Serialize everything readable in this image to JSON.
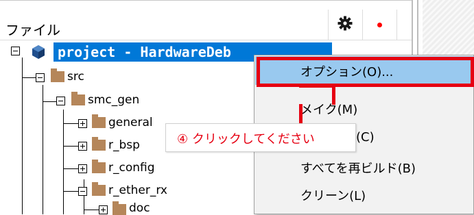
{
  "panel": {
    "header_label": "ファイル",
    "settings_icon": "gear-icon",
    "status_icon": "red-dot-icon",
    "status_color": "#ff0000"
  },
  "tree": {
    "project_label": "project - HardwareDeb",
    "items": [
      {
        "label": "src",
        "state": "expanded"
      },
      {
        "label": "smc_gen",
        "state": "expanded"
      },
      {
        "label": "general",
        "state": "collapsed"
      },
      {
        "label": "r_bsp",
        "state": "collapsed"
      },
      {
        "label": "r_config",
        "state": "collapsed"
      },
      {
        "label": "r_ether_rx",
        "state": "expanded"
      },
      {
        "label": "doc",
        "state": "collapsed"
      }
    ]
  },
  "context_menu": {
    "items": [
      {
        "label": "オプション(O)...",
        "highlighted": true
      },
      {
        "label": "メイク(M)"
      },
      {
        "label": "(C)"
      },
      {
        "label": "すべてを再ビルド(B)"
      },
      {
        "label": "クリーン(L)"
      }
    ]
  },
  "annotation": {
    "callout_text": "④ クリックしてください",
    "color": "#e60012"
  },
  "colors": {
    "selection": "#0078d7",
    "menu_highlight": "#99c9ef",
    "folder": "#b5865a"
  }
}
